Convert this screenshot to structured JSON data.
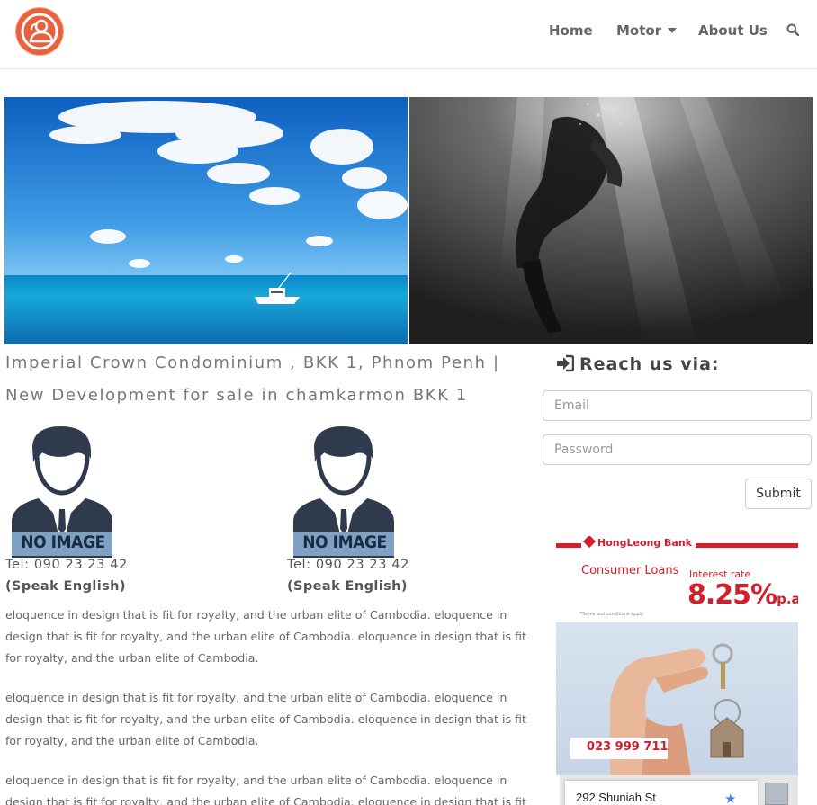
{
  "header": {
    "logo_name": "user-group-icon",
    "nav": [
      {
        "label": "Home"
      },
      {
        "label": "Motor"
      },
      {
        "label": "About Us"
      }
    ],
    "search_icon": "search-icon"
  },
  "listing": {
    "title": "Imperial Crown Condominium , BKK 1, Phnom Penh | New Development for sale in chamkarmon BKK 1",
    "agents": [
      {
        "image_text": "NO IMAGE",
        "tel": "Tel: 090 23 23 42",
        "language": "(Speak English)"
      },
      {
        "image_text": "NO IMAGE",
        "tel": "Tel: 090 23 23 42",
        "language": "(Speak English)"
      }
    ],
    "paragraphs": [
      "eloquence in design that is fit for royalty, and the urban elite of Cambodia. eloquence in design that is fit for royalty, and the urban elite of Cambodia. eloquence in design that is fit for royalty, and the urban elite of Cambodia.",
      "eloquence in design that is fit for royalty, and the urban elite of Cambodia. eloquence in design that is fit for royalty, and the urban elite of Cambodia. eloquence in design that is fit for royalty, and the urban elite of Cambodia.",
      "eloquence in design that is fit for royalty, and the urban elite of Cambodia. eloquence in design that is fit for royalty, and the urban elite of Cambodia. eloquence in design that is fit for royalty, and the urban elite of Cambodia."
    ]
  },
  "sidebar": {
    "heading": "Reach us via:",
    "email_placeholder": "Email",
    "password_placeholder": "Password",
    "submit_label": "Submit"
  },
  "ad": {
    "bank": "HongLeong Bank",
    "product": "Consumer Loans",
    "rate_label": "Interest rate",
    "rate": "8.25%",
    "rate_suffix": "p.a.",
    "terms": "*Terms and conditions apply",
    "phone": "023 999 711",
    "map_address": "292 Shuniah St"
  },
  "colors": {
    "brand": "#e8603c",
    "ad_red": "#d21f2a"
  }
}
